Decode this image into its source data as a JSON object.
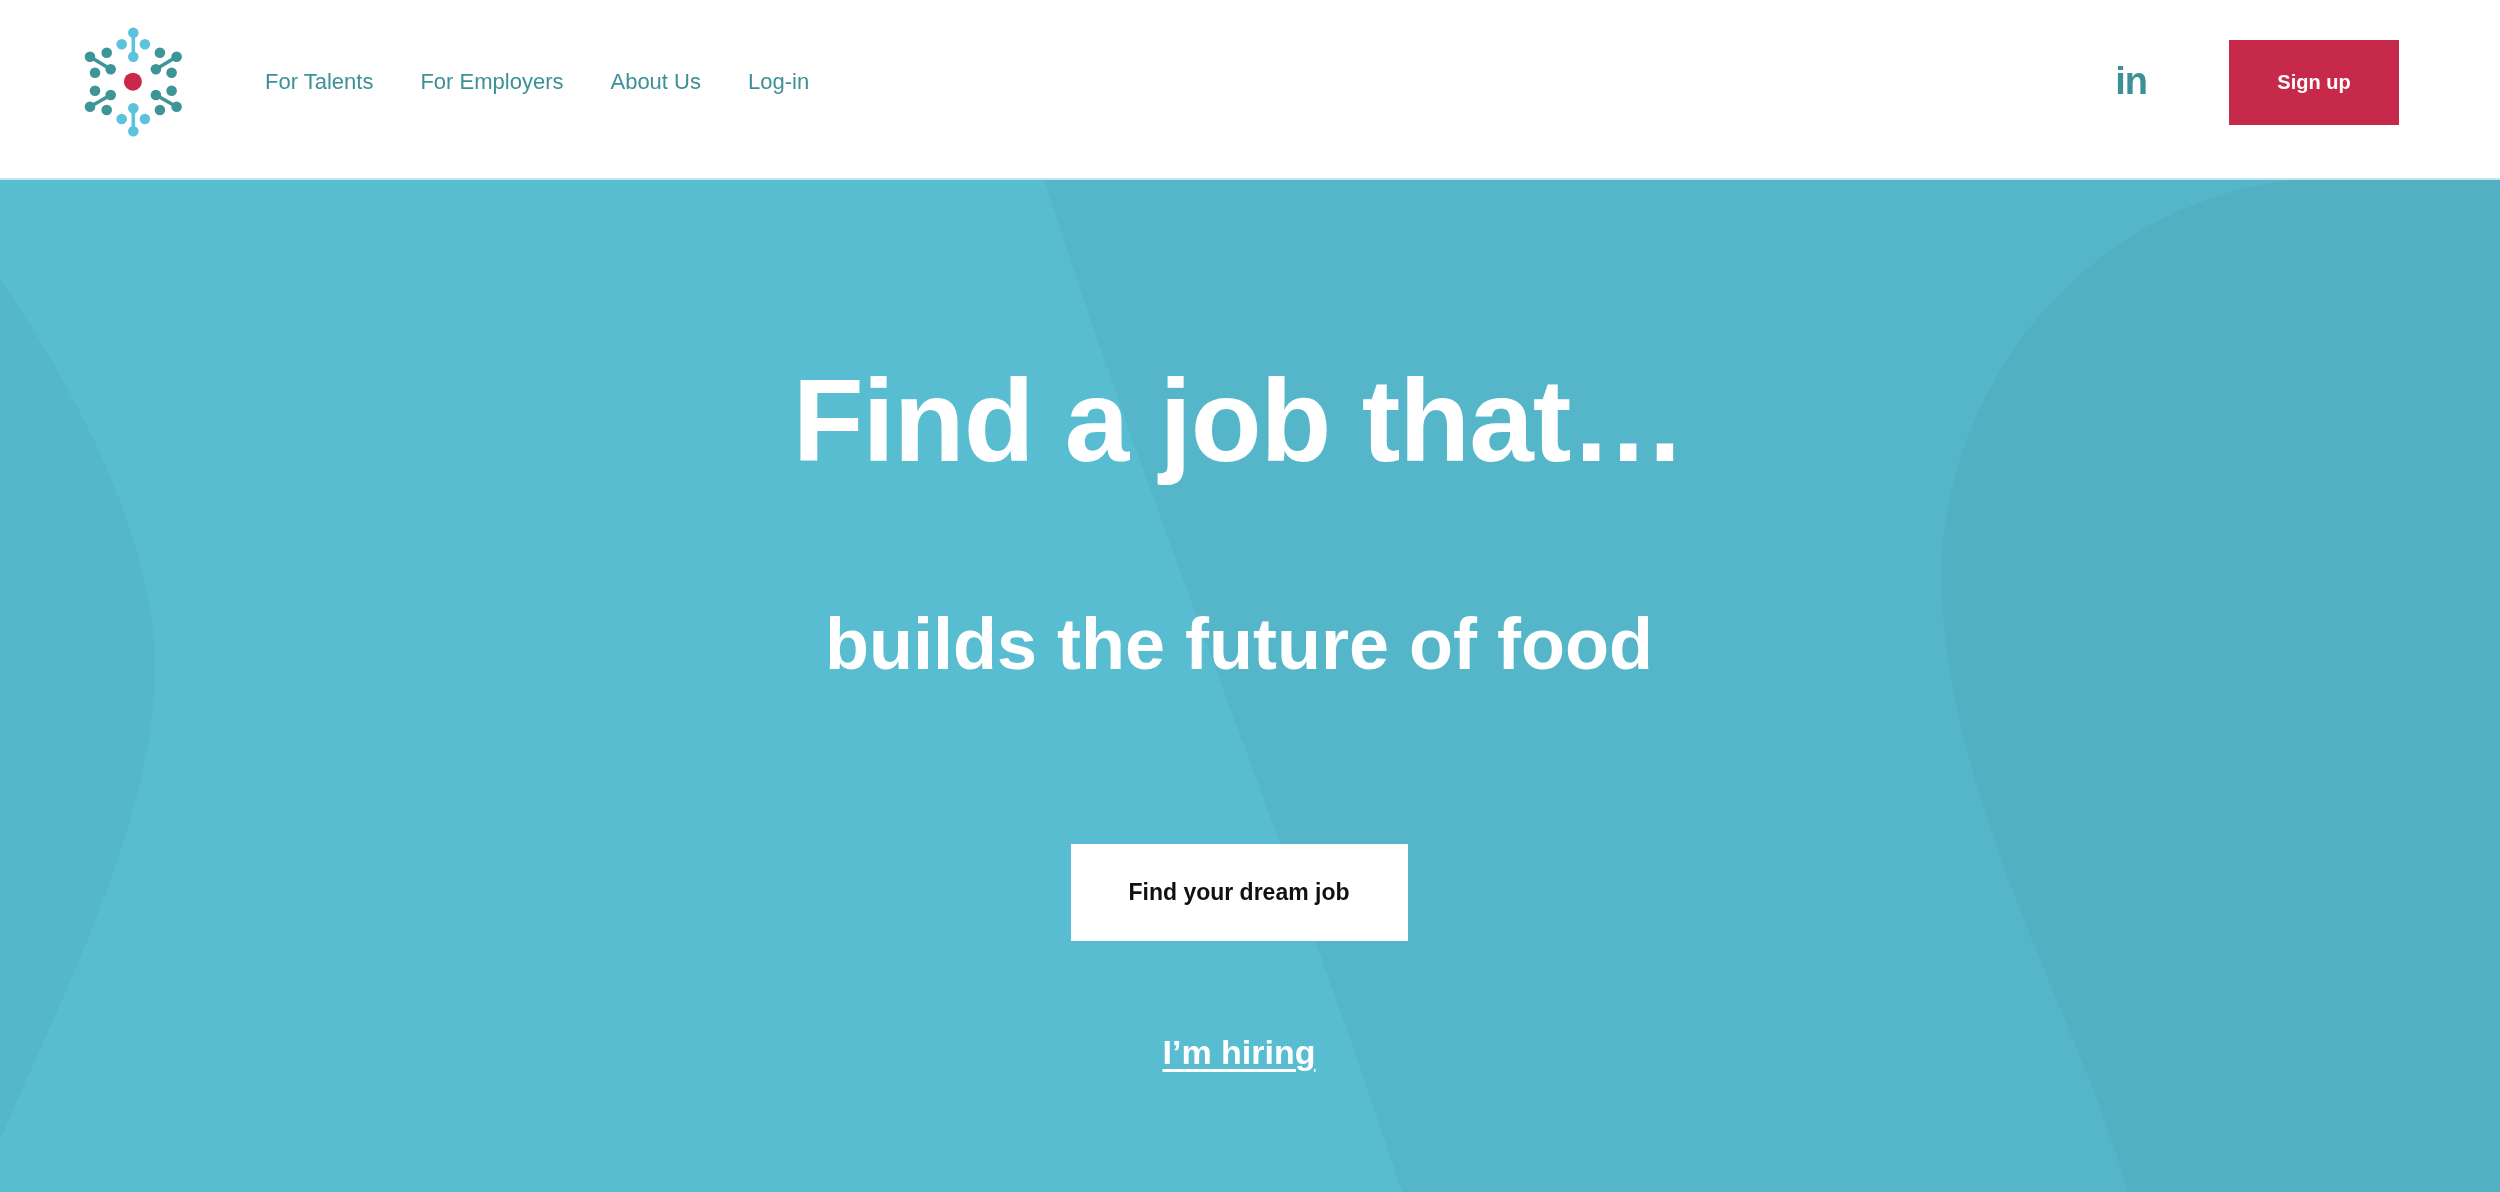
{
  "header": {
    "nav": [
      "For Talents",
      "For Employers",
      "About Us",
      "Log-in"
    ],
    "social_link": {
      "label": "in"
    },
    "signup_button": {
      "label": "Sign up"
    }
  },
  "hero": {
    "title": "Find a job that…",
    "subtitle": "builds the future of food",
    "primary_button": {
      "label": "Find your dream job"
    },
    "secondary_link": {
      "label": "I’m hiring"
    }
  }
}
